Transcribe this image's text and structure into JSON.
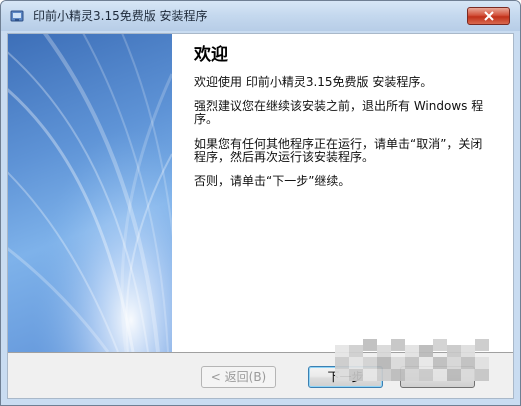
{
  "window": {
    "title": "印前小精灵3.15免费版 安装程序",
    "icon": "installer-icon"
  },
  "content": {
    "heading": "欢迎",
    "paragraphs": [
      "欢迎使用 印前小精灵3.15免费版 安装程序。",
      "强烈建议您在继续该安装之前，退出所有 Windows 程序。",
      "如果您有任何其他程序正在运行，请单击“取消”，关闭程序，然后再次运行该安装程序。",
      "否则，请单击“下一步”继续。"
    ]
  },
  "buttons": {
    "back": "< 返回(B)",
    "next": "下一步",
    "cancel": ""
  },
  "colors": {
    "banner": "#5e93d6",
    "close_button": "#c0311a"
  }
}
